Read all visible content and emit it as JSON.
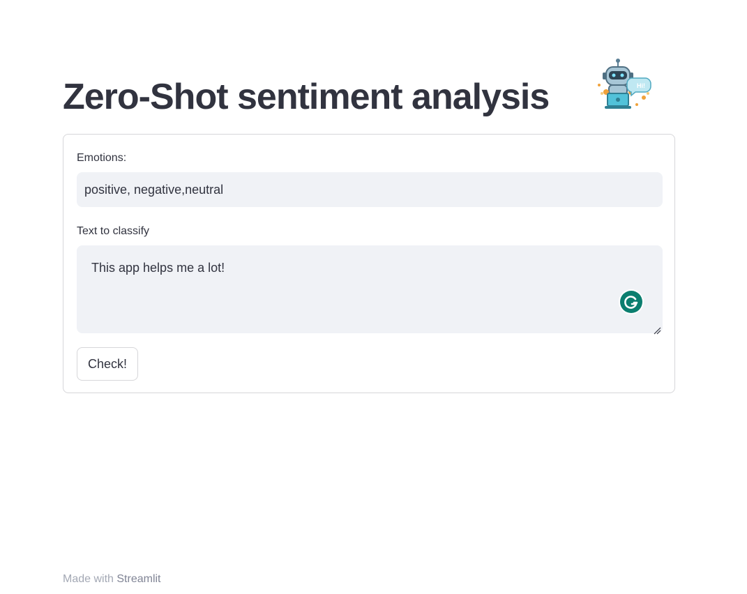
{
  "page": {
    "title": "Zero-Shot sentiment analysis",
    "robot_icon": "robot-hi-icon",
    "robot_badge": "Hi!"
  },
  "form": {
    "emotions_label": "Emotions:",
    "emotions_value": "positive, negative,neutral",
    "text_label": "Text to classify",
    "text_value": "This app helps me a lot!",
    "submit_label": "Check!",
    "grammarly_icon": "grammarly-icon"
  },
  "footer": {
    "prefix": "Made with",
    "brand": "Streamlit"
  },
  "colors": {
    "text": "#31333f",
    "input_bg": "#f0f2f6",
    "border": "#d6d6d9",
    "grammarly": "#0b7e6f",
    "footer_text": "#a3a8b4"
  }
}
